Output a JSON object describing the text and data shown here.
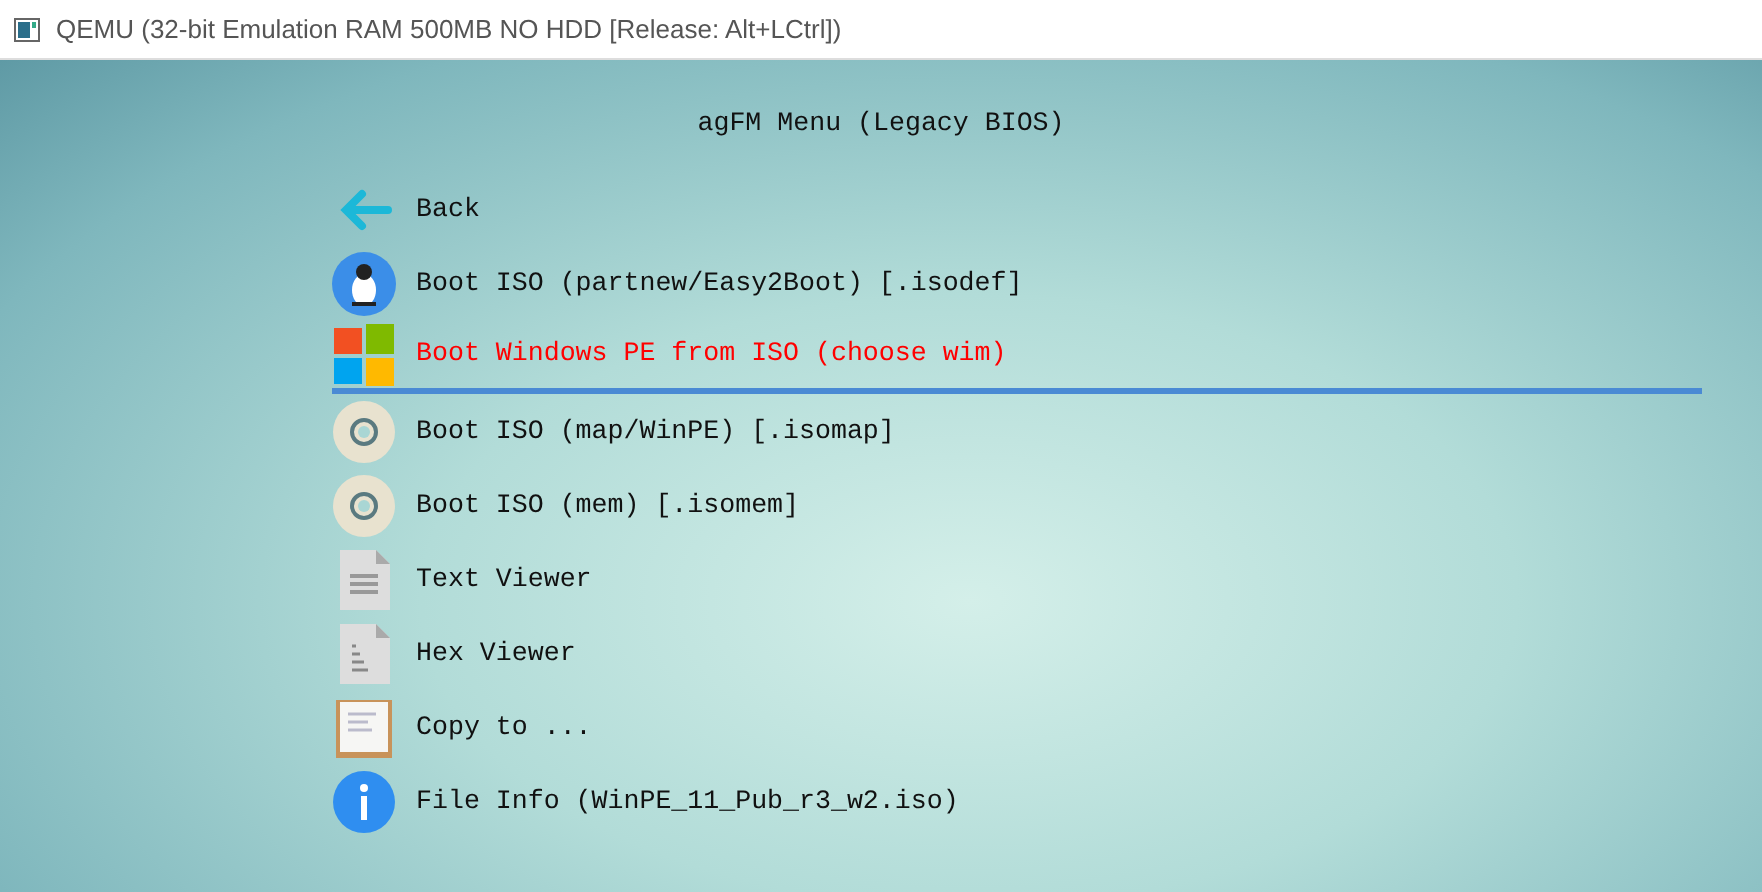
{
  "window": {
    "title": "QEMU (32-bit Emulation RAM 500MB NO HDD [Release: Alt+LCtrl])"
  },
  "menu": {
    "title": "agFM Menu (Legacy BIOS)",
    "items": [
      {
        "kind": "back",
        "label": "Back",
        "selected": false
      },
      {
        "kind": "linux",
        "label": "Boot ISO (partnew/Easy2Boot) [.isodef]",
        "selected": false
      },
      {
        "kind": "windows",
        "label": "Boot Windows PE from ISO (choose wim)",
        "selected": true
      },
      {
        "kind": "disc",
        "label": "Boot ISO (map/WinPE) [.isomap]",
        "selected": false
      },
      {
        "kind": "disc",
        "label": "Boot ISO (mem) [.isomem]",
        "selected": false
      },
      {
        "kind": "text",
        "label": "Text Viewer",
        "selected": false
      },
      {
        "kind": "hex",
        "label": "Hex Viewer",
        "selected": false
      },
      {
        "kind": "copy",
        "label": "Copy to ...",
        "selected": false
      },
      {
        "kind": "info",
        "label": "File Info (WinPE_11_Pub_r3_w2.iso)",
        "selected": false
      }
    ]
  }
}
